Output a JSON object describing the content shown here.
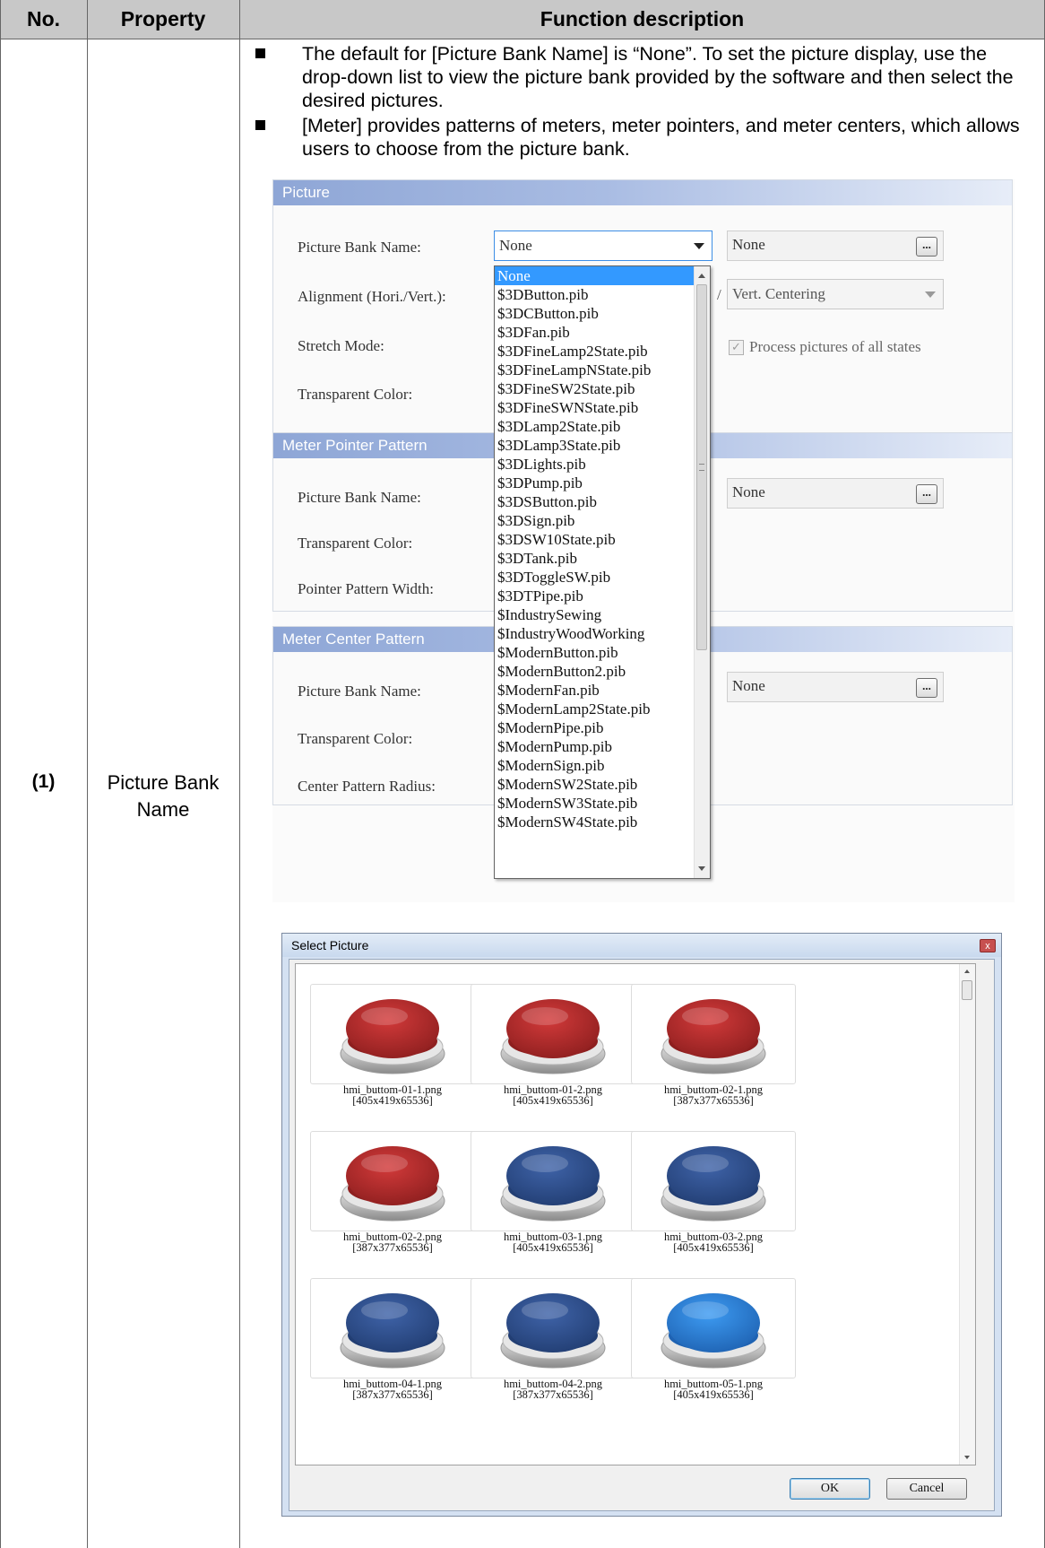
{
  "table": {
    "header": {
      "no": "No.",
      "property": "Property",
      "function": "Function description"
    },
    "row": {
      "no": "(1)",
      "property_line1": "Picture Bank",
      "property_line2": "Name",
      "bullets": [
        "The default for [Picture Bank Name] is “None”. To set the picture display, use the drop-down list to view the picture bank provided by the software and then select the desired pictures.",
        "[Meter] provides patterns of meters, meter pointers, and meter centers, which allows users to choose from the picture bank."
      ]
    }
  },
  "panel": {
    "picture_group": {
      "title": "Picture",
      "picture_bank_label": "Picture Bank Name:",
      "picture_bank_value": "None",
      "picture_value": "None",
      "alignment_label": "Alignment (Hori./Vert.):",
      "alignment_sep": "/",
      "vert_value": "Vert. Centering",
      "stretch_label": "Stretch Mode:",
      "process_all_label": "Process pictures of all states",
      "transparent_label": "Transparent Color:"
    },
    "pointer_group": {
      "title": "Meter Pointer Pattern",
      "picture_bank_label": "Picture Bank Name:",
      "picture_value": "None",
      "transparent_label": "Transparent Color:",
      "width_label": "Pointer Pattern Width:"
    },
    "center_group": {
      "title": "Meter Center Pattern",
      "picture_bank_label": "Picture Bank Name:",
      "picture_value": "None",
      "transparent_label": "Transparent Color:",
      "radius_label": "Center Pattern Radius:"
    },
    "browse_label": "...",
    "dropdown_items": [
      "None",
      "$3DButton.pib",
      "$3DCButton.pib",
      "$3DFan.pib",
      "$3DFineLamp2State.pib",
      "$3DFineLampNState.pib",
      "$3DFineSW2State.pib",
      "$3DFineSWNState.pib",
      "$3DLamp2State.pib",
      "$3DLamp3State.pib",
      "$3DLights.pib",
      "$3DPump.pib",
      "$3DSButton.pib",
      "$3DSign.pib",
      "$3DSW10State.pib",
      "$3DTank.pib",
      "$3DToggleSW.pib",
      "$3DTPipe.pib",
      "$IndustrySewing",
      "$IndustryWoodWorking",
      "$ModernButton.pib",
      "$ModernButton2.pib",
      "$ModernFan.pib",
      "$ModernLamp2State.pib",
      "$ModernPipe.pib",
      "$ModernPump.pib",
      "$ModernSign.pib",
      "$ModernSW2State.pib",
      "$ModernSW3State.pib",
      "$ModernSW4State.pib"
    ],
    "dropdown_selected_index": 0
  },
  "dialog": {
    "title": "Select Picture",
    "close": "x",
    "ok": "OK",
    "cancel": "Cancel",
    "tiles": [
      {
        "name": "hmi_buttom-01-1.png",
        "size": "[405x419x65536]",
        "color": "#d23a3a",
        "dark": "#8e1f1f"
      },
      {
        "name": "hmi_buttom-01-2.png",
        "size": "[405x419x65536]",
        "color": "#d23a3a",
        "dark": "#8e1f1f"
      },
      {
        "name": "hmi_buttom-02-1.png",
        "size": "[387x377x65536]",
        "color": "#d23a3a",
        "dark": "#8e1f1f"
      },
      {
        "name": "hmi_buttom-02-2.png",
        "size": "[387x377x65536]",
        "color": "#d23a3a",
        "dark": "#8e1f1f"
      },
      {
        "name": "hmi_buttom-03-1.png",
        "size": "[405x419x65536]",
        "color": "#3f63a8",
        "dark": "#223e73"
      },
      {
        "name": "hmi_buttom-03-2.png",
        "size": "[405x419x65536]",
        "color": "#3f63a8",
        "dark": "#223e73"
      },
      {
        "name": "hmi_buttom-04-1.png",
        "size": "[387x377x65536]",
        "color": "#3f63a8",
        "dark": "#223e73"
      },
      {
        "name": "hmi_buttom-04-2.png",
        "size": "[387x377x65536]",
        "color": "#3f63a8",
        "dark": "#223e73"
      },
      {
        "name": "hmi_buttom-05-1.png",
        "size": "[405x419x65536]",
        "color": "#3d9bf2",
        "dark": "#1f63b3"
      }
    ]
  }
}
